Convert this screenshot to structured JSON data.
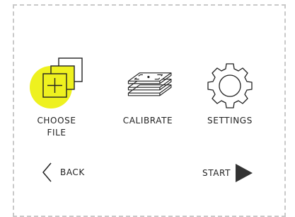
{
  "menu": {
    "choose_file": {
      "label": "CHOOSE\nFILE",
      "icon": "add-file-icon",
      "highlight_color": "#eef11f"
    },
    "calibrate": {
      "label": "CALIBRATE",
      "icon": "calibration-plates-icon"
    },
    "settings": {
      "label": "SETTINGS",
      "icon": "gear-icon"
    }
  },
  "nav": {
    "back_label": "BACK",
    "start_label": "START"
  },
  "colors": {
    "accent": "#eef11f",
    "ink": "#222222",
    "frame": "#c9c9c9"
  }
}
